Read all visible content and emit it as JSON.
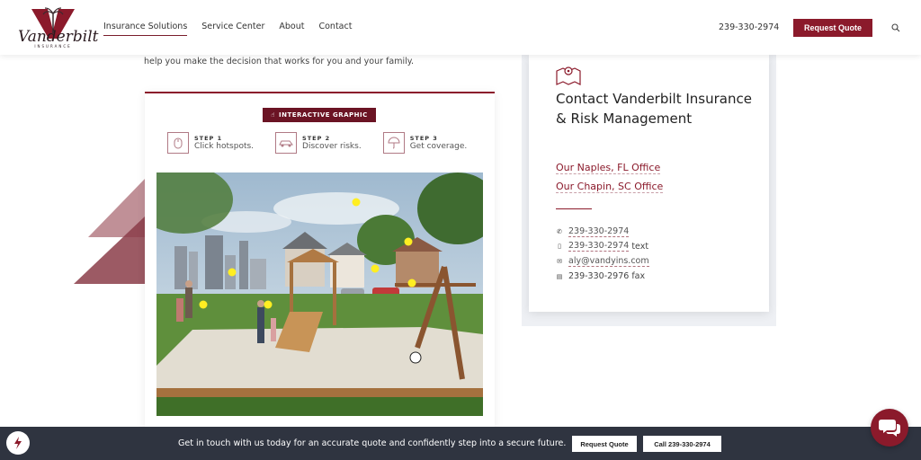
{
  "brand": {
    "name": "Vanderbilt",
    "sub": "INSURANCE",
    "accent": "#8b1a2b"
  },
  "nav": [
    {
      "label": "Insurance Solutions"
    },
    {
      "label": "Service Center"
    },
    {
      "label": "About"
    },
    {
      "label": "Contact"
    }
  ],
  "header": {
    "phone": "239-330-2974",
    "quote_label": "Request Quote",
    "search_icon": "search-icon"
  },
  "intro": {
    "text": "help you make the decision that works for you and your family."
  },
  "graphic": {
    "badge": "INTERACTIVE GRAPHIC",
    "steps": [
      {
        "num": "STEP 1",
        "text": "Click hotspots.",
        "icon": "mouse-icon"
      },
      {
        "num": "STEP 2",
        "text": "Discover risks.",
        "icon": "car-icon"
      },
      {
        "num": "STEP 3",
        "text": "Get coverage.",
        "icon": "umbrella-icon"
      }
    ]
  },
  "contact": {
    "title": "Contact Vanderbilt Insurance & Risk Management",
    "offices": [
      "Our Naples, FL Office",
      "Our Chapin, SC Office"
    ],
    "phone": "239-330-2974",
    "text_phone": "239-330-2974",
    "text_suffix": "text",
    "email": "aly@vandyins.com",
    "fax": "239-330-2976",
    "fax_suffix": "fax"
  },
  "bottom_bar": {
    "text": "Get in touch with us today for an accurate quote and confidently step into a secure future.",
    "quote_label": "Request Quote",
    "call_label": "Call 239-330-2974"
  }
}
